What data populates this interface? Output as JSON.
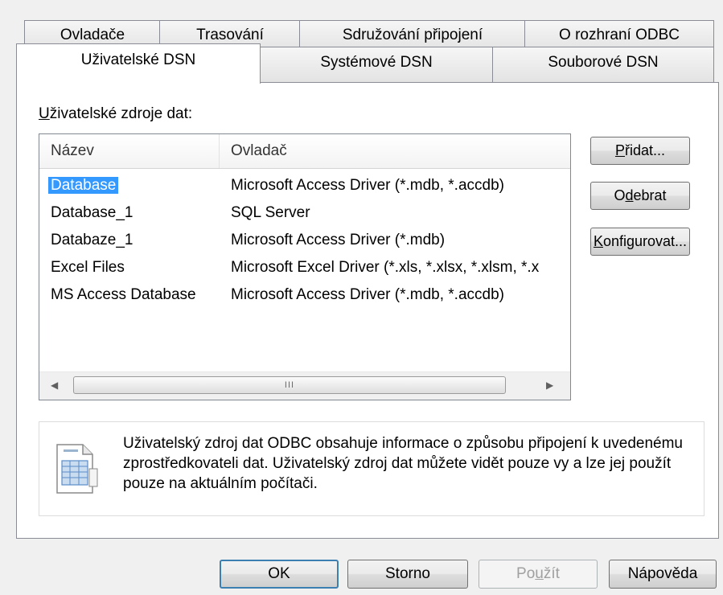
{
  "tabs": {
    "row1": [
      "Ovladače",
      "Trasování",
      "Sdružování připojení",
      "O rozhraní ODBC"
    ],
    "row2": [
      "Uživatelské DSN",
      "Systémové DSN",
      "Souborové DSN"
    ]
  },
  "section_label": {
    "accel": "U",
    "rest": "živatelské zdroje dat:"
  },
  "list": {
    "columns": [
      "Název",
      "Ovladač"
    ],
    "rows": [
      {
        "name": "Database",
        "driver": "Microsoft Access Driver (*.mdb, *.accdb)",
        "selected": true
      },
      {
        "name": "Database_1",
        "driver": "SQL Server"
      },
      {
        "name": "Databaze_1",
        "driver": "Microsoft Access Driver (*.mdb)"
      },
      {
        "name": "Excel Files",
        "driver": "Microsoft Excel Driver (*.xls, *.xlsx, *.xlsm, *.x"
      },
      {
        "name": "MS Access Database",
        "driver": "Microsoft Access Driver (*.mdb, *.accdb)"
      }
    ],
    "scroll_grip": "III"
  },
  "side_buttons": {
    "add": {
      "accel": "P",
      "rest": "řidat..."
    },
    "remove": {
      "pre": "O",
      "accel": "d",
      "rest": "ebrat"
    },
    "configure": {
      "accel": "K",
      "rest": "onfigurovat..."
    }
  },
  "info": {
    "text": "Uživatelský zdroj dat ODBC obsahuje informace o způsobu připojení k uvedenému zprostředkovateli dat. Uživatelský zdroj dat můžete vidět pouze vy a lze jej použít pouze na aktuálním počítači.",
    "icon": "data-source-document-icon"
  },
  "bottom_buttons": {
    "ok": "OK",
    "cancel": "Storno",
    "apply": {
      "pre": "Po",
      "accel": "u",
      "rest": "žít"
    },
    "help": "Nápověda"
  },
  "colors": {
    "selection": "#3399ff",
    "default_button_border": "#3c7fb1"
  }
}
